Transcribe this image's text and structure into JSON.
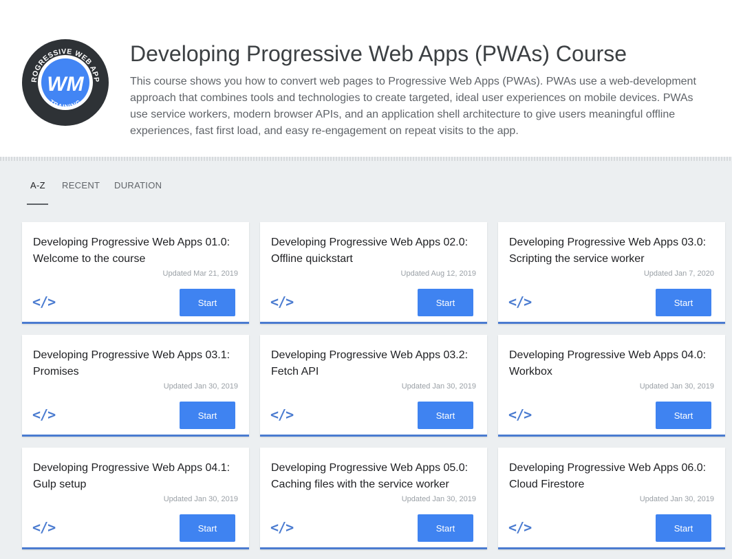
{
  "header": {
    "title": "Developing Progressive Web Apps (PWAs) Course",
    "description": "This course shows you how to convert web pages to Progressive Web Apps (PWAs). PWAs use a web-development approach that combines tools and technologies to create targeted, ideal user experiences on mobile devices. PWAs use service workers, modern browser APIs, and an application shell architecture to give users meaningful offline experiences, fast first load, and easy re-engagement on repeat visits to the app.",
    "badge": {
      "top_text": "PROGRESSIVE WEB APPS",
      "bottom_text": "TRAINING",
      "monogram": "WM"
    }
  },
  "tabs": [
    {
      "label": "A-Z",
      "active": true
    },
    {
      "label": "RECENT",
      "active": false
    },
    {
      "label": "DURATION",
      "active": false
    }
  ],
  "cards": [
    {
      "title": "Developing Progressive Web Apps 01.0: Welcome to the course",
      "updated": "Updated Mar 21, 2019",
      "start_label": "Start",
      "icon": "code-icon"
    },
    {
      "title": "Developing Progressive Web Apps 02.0: Offline quickstart",
      "updated": "Updated Aug 12, 2019",
      "start_label": "Start",
      "icon": "code-icon"
    },
    {
      "title": "Developing Progressive Web Apps 03.0: Scripting the service worker",
      "updated": "Updated Jan 7, 2020",
      "start_label": "Start",
      "icon": "code-icon"
    },
    {
      "title": "Developing Progressive Web Apps 03.1: Promises",
      "updated": "Updated Jan 30, 2019",
      "start_label": "Start",
      "icon": "code-icon"
    },
    {
      "title": "Developing Progressive Web Apps 03.2: Fetch API",
      "updated": "Updated Jan 30, 2019",
      "start_label": "Start",
      "icon": "code-icon"
    },
    {
      "title": "Developing Progressive Web Apps 04.0: Workbox",
      "updated": "Updated Jan 30, 2019",
      "start_label": "Start",
      "icon": "code-icon"
    },
    {
      "title": "Developing Progressive Web Apps 04.1: Gulp setup",
      "updated": "Updated Jan 30, 2019",
      "start_label": "Start",
      "icon": "code-icon"
    },
    {
      "title": "Developing Progressive Web Apps 05.0: Caching files with the service worker",
      "updated": "Updated Jan 30, 2019",
      "start_label": "Start",
      "icon": "code-icon"
    },
    {
      "title": "Developing Progressive Web Apps 06.0: Cloud Firestore",
      "updated": "Updated Jan 30, 2019",
      "start_label": "Start",
      "icon": "code-icon"
    }
  ],
  "code_glyph": "</>",
  "colors": {
    "accent": "#3f83f1",
    "card_border": "#4a7bd0",
    "badge_dark": "#2e3236",
    "badge_blue": "#4285f4"
  }
}
